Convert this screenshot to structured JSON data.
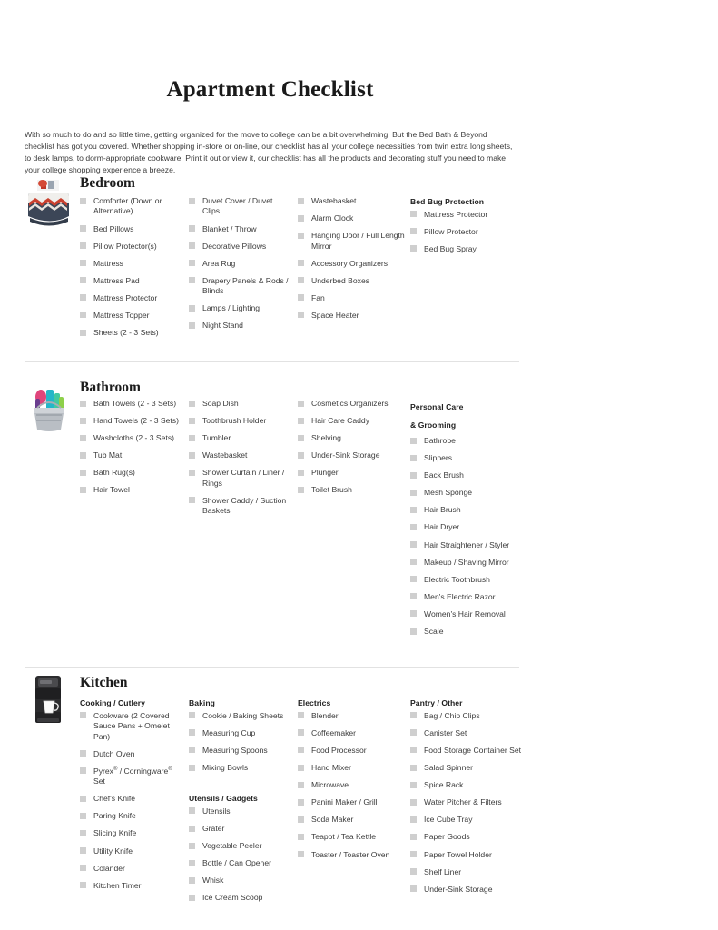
{
  "document": {
    "title": "Apartment Checklist",
    "intro": "With so much to do and so little time, getting organized for the move to college can be a bit overwhelming. But the Bed Bath & Beyond checklist has got you covered. Whether shopping in-store or on-line, our checklist has all your college necessities from twin extra long sheets, to desk lamps, to dorm-appropriate cookware. Print it out or view it, our checklist has all the products and decorating stuff you need to make your college shopping experience a breeze."
  },
  "colors": {
    "checkbox": "#cfcfcf",
    "divider": "#e2e2e2",
    "text": "#3c3c3c",
    "heading": "#1c1c1c"
  },
  "sections": [
    {
      "id": "bedroom",
      "title": "Bedroom",
      "icon": "comforter-bedding-icon",
      "columns": [
        {
          "head": "",
          "items": [
            "Comforter (Down or Alternative)",
            "Bed Pillows",
            "Pillow Protector(s)",
            "Mattress",
            "Mattress Pad",
            "Mattress Protector",
            "Mattress Topper",
            "Sheets (2 - 3 Sets)"
          ]
        },
        {
          "head": "",
          "items": [
            "Duvet Cover / Duvet Clips",
            "Blanket / Throw",
            "Decorative Pillows",
            "Area Rug",
            "Drapery Panels & Rods / Blinds",
            "Lamps / Lighting",
            "Night Stand"
          ]
        },
        {
          "head": "",
          "items": [
            "Wastebasket",
            "Alarm Clock",
            "Hanging Door / Full Length Mirror",
            "Accessory Organizers",
            "Underbed Boxes",
            "Fan",
            "Space Heater"
          ]
        },
        {
          "head": "Bed Bug Protection",
          "items": [
            "Mattress Protector",
            "Pillow Protector",
            "Bed Bug Spray"
          ]
        }
      ]
    },
    {
      "id": "bathroom",
      "title": "Bathroom",
      "icon": "shower-caddy-icon",
      "columns": [
        {
          "head": "",
          "items": [
            "Bath Towels (2 - 3 Sets)",
            "Hand Towels (2 - 3 Sets)",
            "Washcloths (2 - 3 Sets)",
            "Tub Mat",
            "Bath Rug(s)",
            "Hair Towel"
          ]
        },
        {
          "head": "",
          "items": [
            "Soap Dish",
            "Toothbrush Holder",
            "Tumbler",
            "Wastebasket",
            "Shower Curtain / Liner / Rings",
            "Shower Caddy / Suction Baskets"
          ]
        },
        {
          "head": "",
          "items": [
            "Cosmetics Organizers",
            "Hair Care Caddy",
            "Shelving",
            "Under-Sink Storage",
            "Plunger",
            "Toilet Brush"
          ]
        },
        {
          "head": "Personal Care\n& Grooming",
          "items": [
            "Bathrobe",
            "Slippers",
            "Back Brush",
            "Mesh Sponge",
            "Hair Brush",
            "Hair Dryer",
            "Hair Straightener / Styler",
            "Makeup / Shaving Mirror",
            "Electric Toothbrush",
            "Men's Electric Razor",
            "Women's Hair Removal",
            "Scale"
          ]
        }
      ]
    },
    {
      "id": "kitchen",
      "title": "Kitchen",
      "icon": "coffee-maker-icon",
      "columns": [
        {
          "head": "Cooking / Cutlery",
          "items": [
            "Cookware (2 Covered Sauce Pans + Omelet Pan)",
            "Dutch Oven",
            "Pyrex® / Corningware® Set",
            "Chef's Knife",
            "Paring Knife",
            "Slicing Knife",
            "Utility Knife",
            "Colander",
            "Kitchen Timer"
          ]
        },
        {
          "head": "Baking",
          "items": [
            "Cookie / Baking Sheets",
            "Measuring Cup",
            "Measuring Spoons",
            "Mixing Bowls"
          ],
          "head2": "Utensils / Gadgets",
          "items2": [
            "Utensils",
            "Grater",
            "Vegetable Peeler",
            "Bottle / Can Opener",
            "Whisk",
            "Ice Cream Scoop"
          ]
        },
        {
          "head": "Electrics",
          "items": [
            "Blender",
            "Coffeemaker",
            "Food Processor",
            "Hand Mixer",
            "Microwave",
            "Panini Maker / Grill",
            "Soda Maker",
            "Teapot / Tea Kettle",
            "Toaster / Toaster Oven"
          ]
        },
        {
          "head": "Pantry / Other",
          "items": [
            "Bag / Chip Clips",
            "Canister Set",
            "Food Storage Container Set",
            "Salad Spinner",
            "Spice Rack",
            "Water Pitcher & Filters",
            "Ice Cube Tray",
            "Paper Goods",
            "Paper Towel Holder",
            "Shelf Liner",
            "Under-Sink Storage"
          ]
        }
      ]
    }
  ]
}
